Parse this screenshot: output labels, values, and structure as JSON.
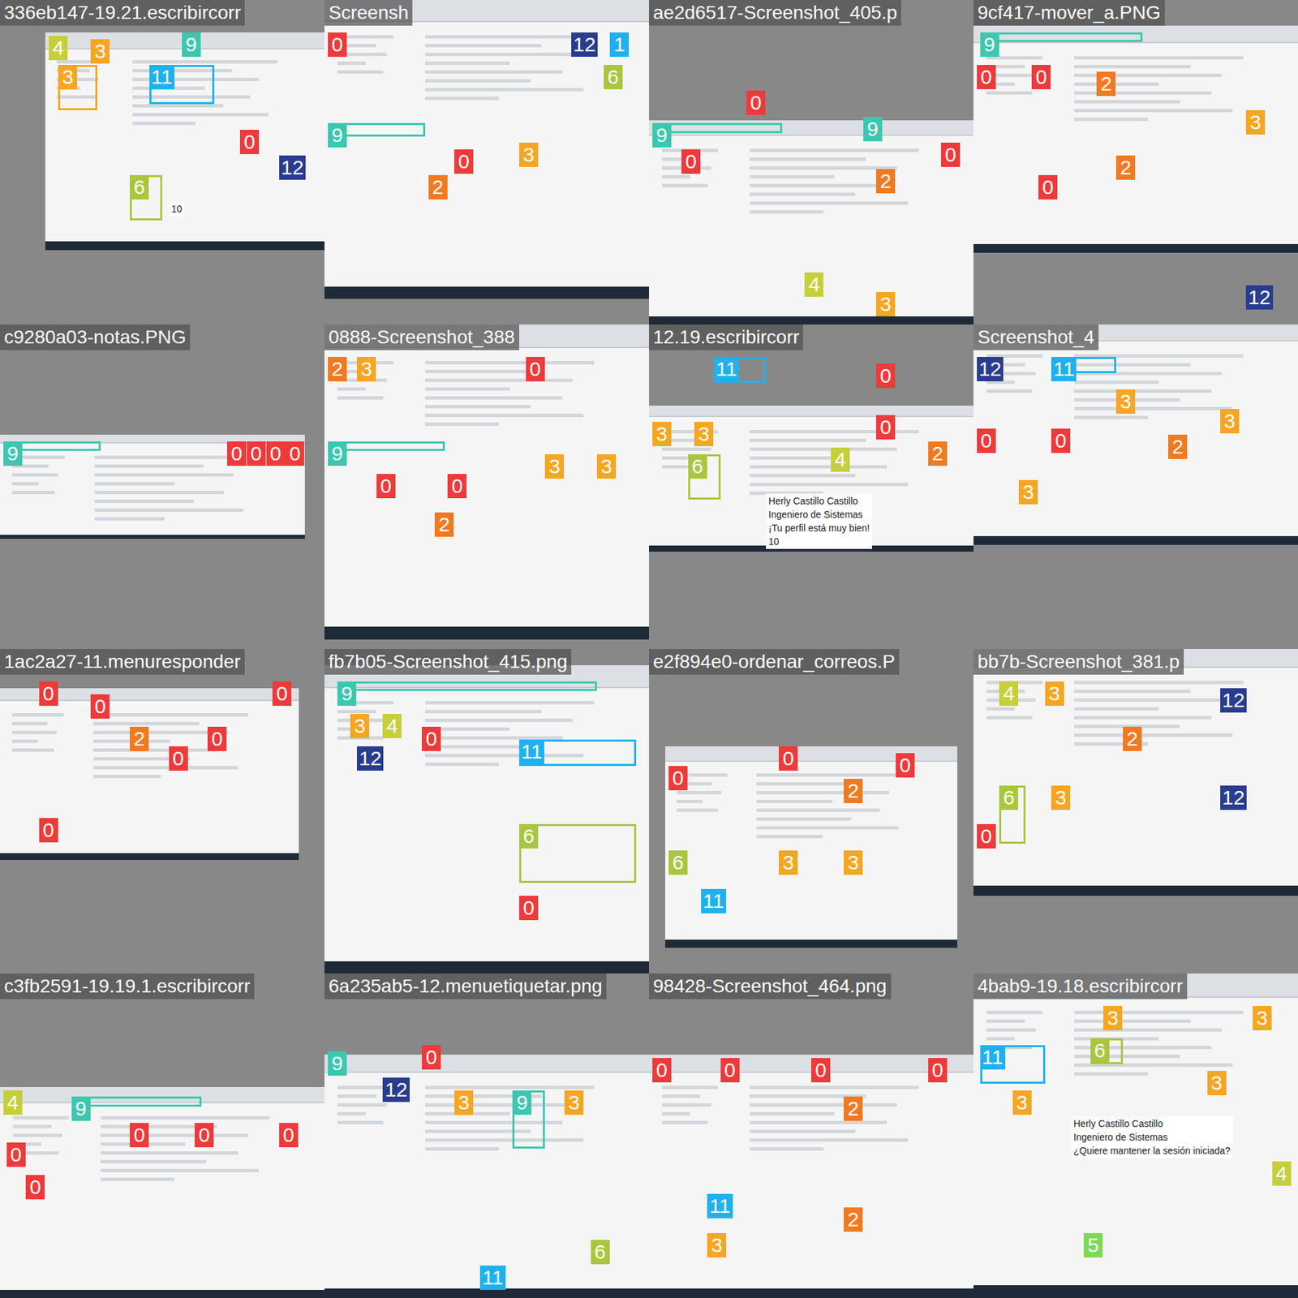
{
  "mosaic": {
    "tiles": [
      {
        "filename": "336eb147-19.21.escribircorr",
        "texts": [
          "10"
        ],
        "annotations": [
          {
            "label": "4",
            "color": "#c6cf3a"
          },
          {
            "label": "3",
            "color": "#f5a623"
          },
          {
            "label": "3",
            "color": "#f5a623"
          },
          {
            "label": "11",
            "color": "#1fb1ef"
          },
          {
            "label": "6",
            "color": "#a9c63e"
          },
          {
            "label": "0",
            "color": "#ee3a3a"
          },
          {
            "label": "12",
            "color": "#293c8e"
          },
          {
            "label": "9",
            "color": "#3cc7b0"
          }
        ]
      },
      {
        "filename": "Screensh",
        "texts": [],
        "annotations": [
          {
            "label": "0",
            "color": "#ee3a3a"
          },
          {
            "label": "12",
            "color": "#293c8e"
          },
          {
            "label": "1",
            "color": "#1fb1ef"
          },
          {
            "label": "6",
            "color": "#a9c63e"
          },
          {
            "label": "9",
            "color": "#3cc7b0"
          },
          {
            "label": "2",
            "color": "#f07a22"
          },
          {
            "label": "3",
            "color": "#f5a623"
          },
          {
            "label": "0",
            "color": "#ee3a3a"
          }
        ]
      },
      {
        "filename": "ae2d6517-Screenshot_405.p",
        "texts": [],
        "annotations": [
          {
            "label": "9",
            "color": "#3cc7b0"
          },
          {
            "label": "0",
            "color": "#ee3a3a"
          },
          {
            "label": "0",
            "color": "#ee3a3a"
          },
          {
            "label": "9",
            "color": "#3cc7b0"
          },
          {
            "label": "2",
            "color": "#f07a22"
          },
          {
            "label": "0",
            "color": "#ee3a3a"
          },
          {
            "label": "4",
            "color": "#c6cf3a"
          },
          {
            "label": "3",
            "color": "#f5a623"
          }
        ]
      },
      {
        "filename": "9cf417-mover_a.PNG",
        "texts": [],
        "annotations": [
          {
            "label": "9",
            "color": "#3cc7b0"
          },
          {
            "label": "0",
            "color": "#ee3a3a"
          },
          {
            "label": "0",
            "color": "#ee3a3a"
          },
          {
            "label": "2",
            "color": "#f07a22"
          },
          {
            "label": "2",
            "color": "#f07a22"
          },
          {
            "label": "0",
            "color": "#ee3a3a"
          },
          {
            "label": "3",
            "color": "#f5a623"
          },
          {
            "label": "12",
            "color": "#293c8e"
          }
        ]
      },
      {
        "filename": "c9280a03-notas.PNG",
        "texts": [],
        "annotations": [
          {
            "label": "9",
            "color": "#3cc7b0"
          },
          {
            "label": "0",
            "color": "#ee3a3a"
          },
          {
            "label": "0",
            "color": "#ee3a3a"
          },
          {
            "label": "0",
            "color": "#ee3a3a"
          },
          {
            "label": "0",
            "color": "#ee3a3a"
          }
        ]
      },
      {
        "filename": "0888-Screenshot_388",
        "texts": [],
        "annotations": [
          {
            "label": "2",
            "color": "#f07a22"
          },
          {
            "label": "3",
            "color": "#f5a623"
          },
          {
            "label": "0",
            "color": "#ee3a3a"
          },
          {
            "label": "9",
            "color": "#3cc7b0"
          },
          {
            "label": "0",
            "color": "#ee3a3a"
          },
          {
            "label": "0",
            "color": "#ee3a3a"
          },
          {
            "label": "2",
            "color": "#f07a22"
          },
          {
            "label": "3",
            "color": "#f5a623"
          },
          {
            "label": "3",
            "color": "#f5a623"
          }
        ]
      },
      {
        "filename": "12.19.escribircorr",
        "texts": [
          "Herly Castillo Castillo",
          "Ingeniero de Sistemas",
          "¡Tu perfil está muy bien!",
          "10"
        ],
        "annotations": [
          {
            "label": "11",
            "color": "#1fb1ef"
          },
          {
            "label": "0",
            "color": "#ee3a3a"
          },
          {
            "label": "3",
            "color": "#f5a623"
          },
          {
            "label": "3",
            "color": "#f5a623"
          },
          {
            "label": "6",
            "color": "#a9c63e"
          },
          {
            "label": "4",
            "color": "#c6cf3a"
          },
          {
            "label": "0",
            "color": "#ee3a3a"
          },
          {
            "label": "2",
            "color": "#f07a22"
          }
        ]
      },
      {
        "filename": "Screenshot_4",
        "texts": [],
        "annotations": [
          {
            "label": "12",
            "color": "#293c8e"
          },
          {
            "label": "11",
            "color": "#1fb1ef"
          },
          {
            "label": "0",
            "color": "#ee3a3a"
          },
          {
            "label": "0",
            "color": "#ee3a3a"
          },
          {
            "label": "3",
            "color": "#f5a623"
          },
          {
            "label": "3",
            "color": "#f5a623"
          },
          {
            "label": "3",
            "color": "#f5a623"
          },
          {
            "label": "2",
            "color": "#f07a22"
          }
        ]
      },
      {
        "filename": "1ac2a27-11.menuresponder",
        "texts": [],
        "annotations": [
          {
            "label": "0",
            "color": "#ee3a3a"
          },
          {
            "label": "0",
            "color": "#ee3a3a"
          },
          {
            "label": "2",
            "color": "#f07a22"
          },
          {
            "label": "0",
            "color": "#ee3a3a"
          },
          {
            "label": "0",
            "color": "#ee3a3a"
          },
          {
            "label": "0",
            "color": "#ee3a3a"
          },
          {
            "label": "0",
            "color": "#ee3a3a"
          }
        ]
      },
      {
        "filename": "fb7b05-Screenshot_415.png",
        "texts": [],
        "annotations": [
          {
            "label": "9",
            "color": "#3cc7b0"
          },
          {
            "label": "3",
            "color": "#f5a623"
          },
          {
            "label": "4",
            "color": "#c6cf3a"
          },
          {
            "label": "12",
            "color": "#293c8e"
          },
          {
            "label": "11",
            "color": "#1fb1ef"
          },
          {
            "label": "6",
            "color": "#a9c63e"
          },
          {
            "label": "0",
            "color": "#ee3a3a"
          },
          {
            "label": "0",
            "color": "#ee3a3a"
          }
        ]
      },
      {
        "filename": "e2f894e0-ordenar_correos.P",
        "texts": [],
        "annotations": [
          {
            "label": "0",
            "color": "#ee3a3a"
          },
          {
            "label": "0",
            "color": "#ee3a3a"
          },
          {
            "label": "2",
            "color": "#f07a22"
          },
          {
            "label": "0",
            "color": "#ee3a3a"
          },
          {
            "label": "3",
            "color": "#f5a623"
          },
          {
            "label": "3",
            "color": "#f5a623"
          },
          {
            "label": "11",
            "color": "#1fb1ef"
          },
          {
            "label": "6",
            "color": "#a9c63e"
          }
        ]
      },
      {
        "filename": "bb7b-Screenshot_381.p",
        "texts": [],
        "annotations": [
          {
            "label": "4",
            "color": "#c6cf3a"
          },
          {
            "label": "3",
            "color": "#f5a623"
          },
          {
            "label": "12",
            "color": "#293c8e"
          },
          {
            "label": "2",
            "color": "#f07a22"
          },
          {
            "label": "6",
            "color": "#a9c63e"
          },
          {
            "label": "3",
            "color": "#f5a623"
          },
          {
            "label": "12",
            "color": "#293c8e"
          },
          {
            "label": "0",
            "color": "#ee3a3a"
          }
        ]
      },
      {
        "filename": "c3fb2591-19.19.1.escribircorr",
        "texts": [],
        "annotations": [
          {
            "label": "4",
            "color": "#c6cf3a"
          },
          {
            "label": "9",
            "color": "#3cc7b0"
          },
          {
            "label": "0",
            "color": "#ee3a3a"
          },
          {
            "label": "0",
            "color": "#ee3a3a"
          },
          {
            "label": "0",
            "color": "#ee3a3a"
          },
          {
            "label": "0",
            "color": "#ee3a3a"
          },
          {
            "label": "0",
            "color": "#ee3a3a"
          }
        ]
      },
      {
        "filename": "6a235ab5-12.menuetiquetar.png",
        "texts": [],
        "annotations": [
          {
            "label": "9",
            "color": "#3cc7b0"
          },
          {
            "label": "12",
            "color": "#293c8e"
          },
          {
            "label": "0",
            "color": "#ee3a3a"
          },
          {
            "label": "3",
            "color": "#f5a623"
          },
          {
            "label": "9",
            "color": "#3cc7b0"
          },
          {
            "label": "3",
            "color": "#f5a623"
          },
          {
            "label": "6",
            "color": "#a9c63e"
          },
          {
            "label": "11",
            "color": "#1fb1ef"
          }
        ]
      },
      {
        "filename": "98428-Screenshot_464.png",
        "texts": [],
        "annotations": [
          {
            "label": "0",
            "color": "#ee3a3a"
          },
          {
            "label": "0",
            "color": "#ee3a3a"
          },
          {
            "label": "0",
            "color": "#ee3a3a"
          },
          {
            "label": "2",
            "color": "#f07a22"
          },
          {
            "label": "11",
            "color": "#1fb1ef"
          },
          {
            "label": "3",
            "color": "#f5a623"
          },
          {
            "label": "2",
            "color": "#f07a22"
          },
          {
            "label": "0",
            "color": "#ee3a3a"
          }
        ]
      },
      {
        "filename": "4bab9-19.18.escribircorr",
        "texts": [
          "Herly Castillo Castillo",
          "Ingeniero de Sistemas",
          "¿Quiere mantener la sesión iniciada?"
        ],
        "annotations": [
          {
            "label": "3",
            "color": "#f5a623"
          },
          {
            "label": "6",
            "color": "#a9c63e"
          },
          {
            "label": "11",
            "color": "#1fb1ef"
          },
          {
            "label": "3",
            "color": "#f5a623"
          },
          {
            "label": "3",
            "color": "#f5a623"
          },
          {
            "label": "3",
            "color": "#f5a623"
          },
          {
            "label": "4",
            "color": "#c6cf3a"
          },
          {
            "label": "5",
            "color": "#7ed957"
          }
        ]
      }
    ]
  }
}
